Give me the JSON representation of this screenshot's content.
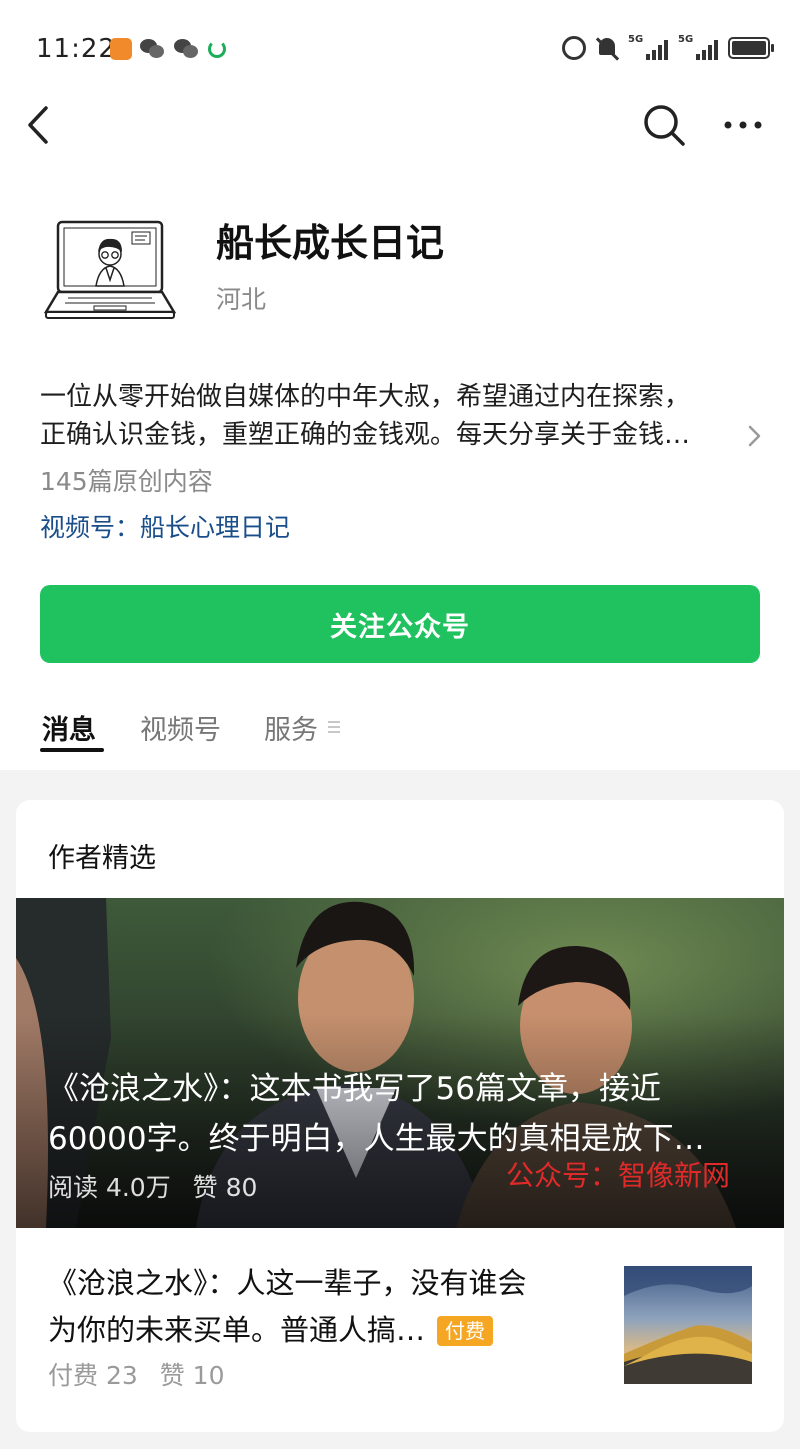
{
  "status_bar": {
    "time": "11:22",
    "left_icons": [
      "app-notification-icon",
      "wechat-icon",
      "wechat-icon",
      "sync-icon"
    ],
    "right_icons": [
      "alarm-icon",
      "mute-icon",
      "signal-5g-icon",
      "signal-5g-icon",
      "battery-icon"
    ],
    "network_labels": [
      "5G",
      "5G"
    ]
  },
  "nav": {
    "icons": [
      "back-icon",
      "search-icon",
      "more-icon"
    ]
  },
  "profile": {
    "name": "船长成长日记",
    "location": "河北",
    "description_lines": [
      "一位从零开始做自媒体的中年大叔，希望通过内在探索，",
      "正确认识金钱，重塑正确的金钱观。每天分享关于金钱…"
    ],
    "original_count": "145篇原创内容",
    "channel": "视频号：船长心理日记"
  },
  "follow_button": {
    "label": "关注公众号",
    "color": "#1fc25e"
  },
  "tabs": [
    {
      "label": "消息",
      "active": true
    },
    {
      "label": "视频号",
      "active": false
    },
    {
      "label": "服务",
      "active": false
    }
  ],
  "featured": {
    "section_title": "作者精选",
    "hero": {
      "title_lines": [
        "《沧浪之水》：这本书我写了56篇文章，接近",
        "60000字。终于明白，人生最大的真相是放下…"
      ],
      "reads": "阅读 4.0万",
      "likes": "赞 80",
      "watermark": "公众号：智像新网"
    },
    "article": {
      "title_line1": "《沧浪之水》：人这一辈子，没有谁会",
      "title_line2": "为你的未来买单。普通人搞…",
      "badge": "付费",
      "paid_count": "付费 23",
      "likes": "赞 10"
    }
  }
}
